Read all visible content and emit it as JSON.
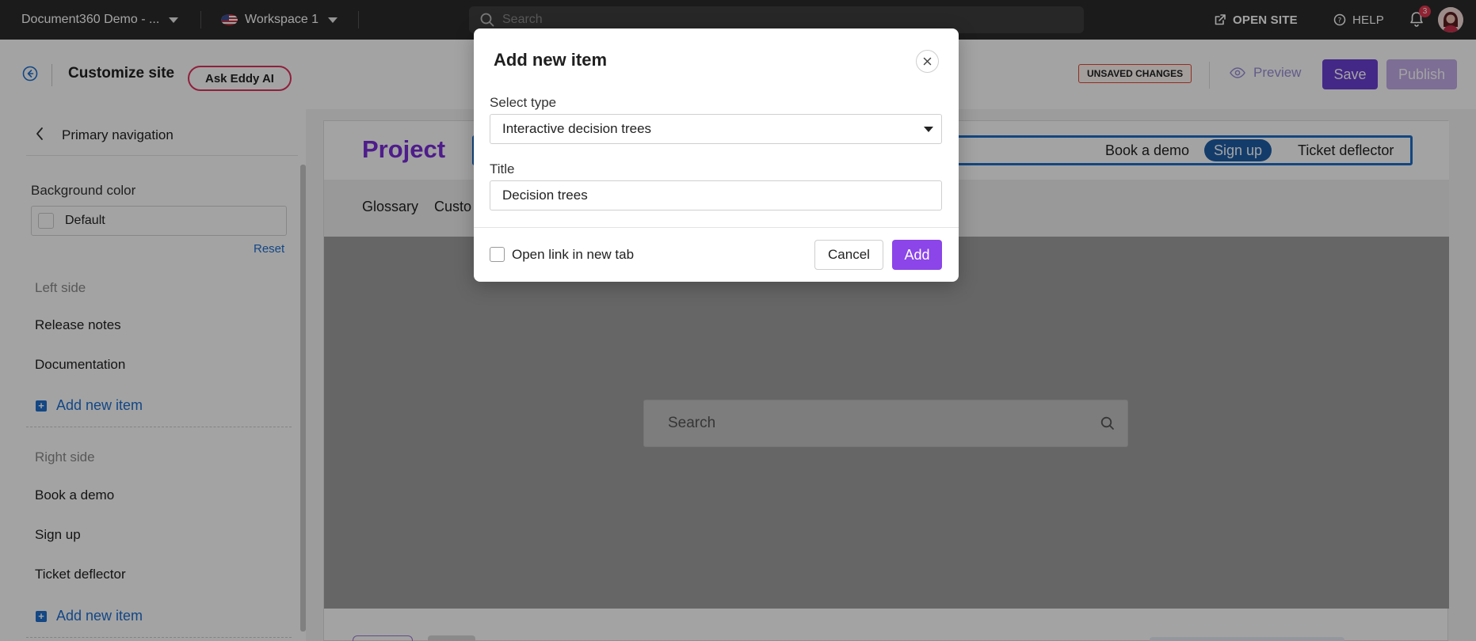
{
  "topbar": {
    "project_name": "Document360 Demo - ...",
    "workspace": "Workspace 1",
    "search_placeholder": "Search",
    "open_site": "OPEN SITE",
    "help": "HELP",
    "notification_count": "3"
  },
  "header": {
    "title": "Customize site",
    "eddy_ai": "Ask Eddy AI",
    "unsaved": "UNSAVED CHANGES",
    "preview": "Preview",
    "save": "Save",
    "publish": "Publish"
  },
  "sidebar": {
    "title": "Primary navigation",
    "background_color_label": "Background color",
    "background_color_value": "Default",
    "reset": "Reset",
    "left_group": "Left side",
    "left_items": [
      "Release notes",
      "Documentation"
    ],
    "right_group": "Right side",
    "right_items": [
      "Book a demo",
      "Sign up",
      "Ticket deflector"
    ],
    "add_new_item": "Add new item"
  },
  "preview_site": {
    "logo": "Project",
    "nav_right": [
      "Book a demo",
      "Sign up",
      "Ticket deflector"
    ],
    "sub_nav": [
      "Glossary",
      "Custo"
    ],
    "search_placeholder": "Search"
  },
  "modal": {
    "title": "Add new item",
    "select_type_label": "Select type",
    "select_type_value": "Interactive decision trees",
    "title_label": "Title",
    "title_value": "Decision trees",
    "open_new_tab": "Open link in new tab",
    "cancel": "Cancel",
    "add": "Add"
  },
  "colors": {
    "accent_purple": "#6b3fd4",
    "add_button": "#8b45e8",
    "link_blue": "#1f6fd1",
    "nav_highlight": "#1e6ec8",
    "logo_purple": "#7b2cd9",
    "unsaved_border": "#e14a33"
  }
}
